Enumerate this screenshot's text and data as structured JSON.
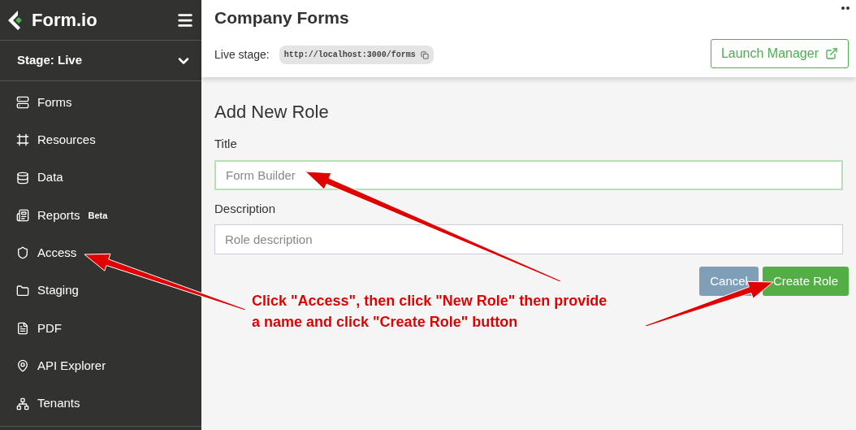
{
  "sidebar": {
    "logo": "Form.io",
    "stage": "Stage: Live",
    "items": [
      {
        "label": "Forms"
      },
      {
        "label": "Resources"
      },
      {
        "label": "Data"
      },
      {
        "label": "Reports",
        "badge": "Beta"
      },
      {
        "label": "Access"
      },
      {
        "label": "Staging"
      },
      {
        "label": "PDF"
      },
      {
        "label": "API Explorer"
      },
      {
        "label": "Tenants"
      }
    ]
  },
  "header": {
    "title": "Company Forms",
    "stage_label": "Live stage:",
    "url": "http://localhost:3000/forms",
    "launch_button": "Launch Manager"
  },
  "form": {
    "heading": "Add New Role",
    "fields": [
      {
        "label": "Title",
        "placeholder": "Form Builder",
        "focused": true
      },
      {
        "label": "Description",
        "placeholder": "Role description",
        "focused": false
      }
    ],
    "buttons": [
      {
        "label": "Cancel",
        "kind": "secondary"
      },
      {
        "label": "Create Role",
        "kind": "primary"
      }
    ]
  },
  "annotation": {
    "lines": [
      "Click \"Access\", then click \"New Role\" then provide",
      "a name and click \"Create Role\" button"
    ]
  }
}
